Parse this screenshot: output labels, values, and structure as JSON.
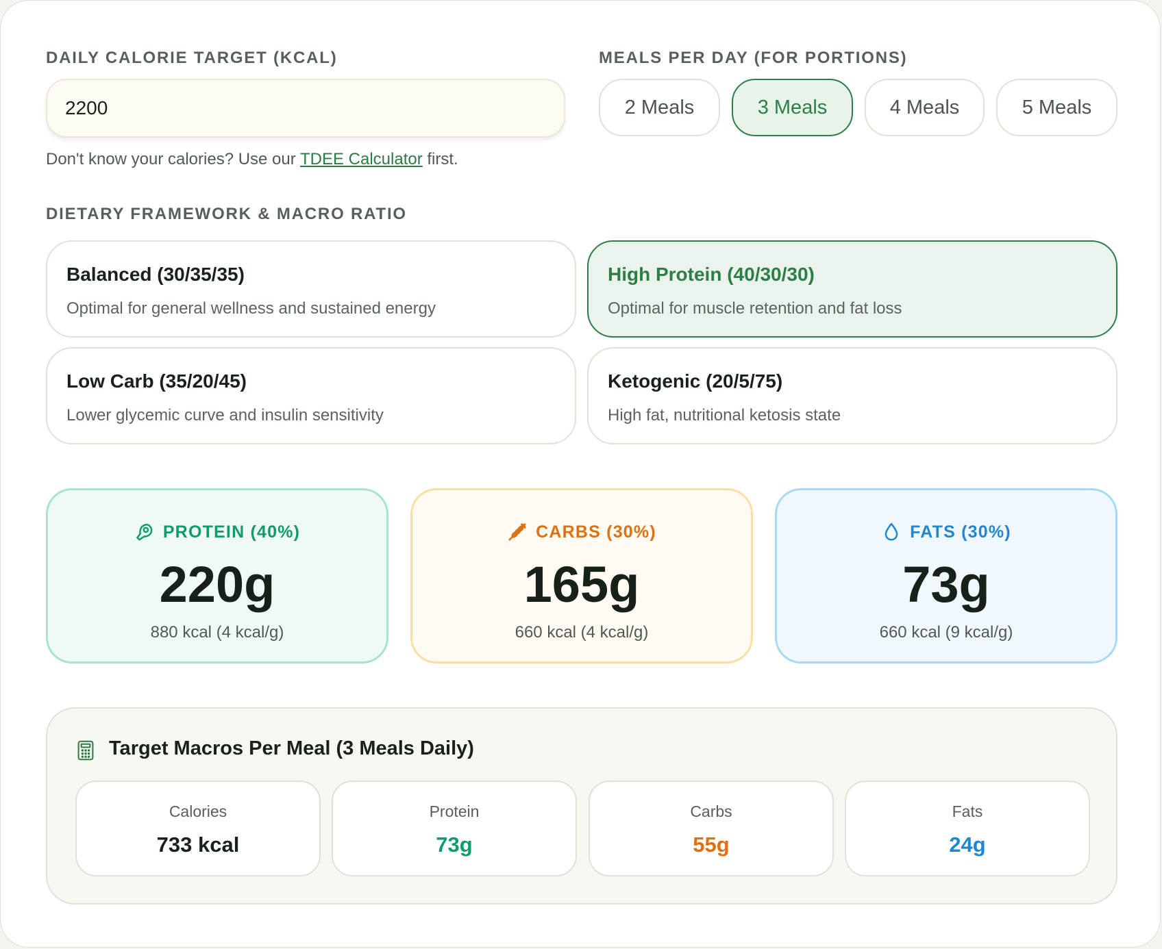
{
  "calorie": {
    "label": "DAILY CALORIE TARGET (KCAL)",
    "value": "2200",
    "helper_prefix": "Don't know your calories? Use our ",
    "helper_link": "TDEE Calculator",
    "helper_suffix": " first."
  },
  "meals": {
    "label": "MEALS PER DAY (FOR PORTIONS)",
    "options": [
      "2 Meals",
      "3 Meals",
      "4 Meals",
      "5 Meals"
    ],
    "selected": "3 Meals"
  },
  "diet": {
    "label": "DIETARY FRAMEWORK & MACRO RATIO",
    "options": [
      {
        "title": "Balanced (30/35/35)",
        "desc": "Optimal for general wellness and sustained energy"
      },
      {
        "title": "High Protein (40/30/30)",
        "desc": "Optimal for muscle retention and fat loss"
      },
      {
        "title": "Low Carb (35/20/45)",
        "desc": "Lower glycemic curve and insulin sensitivity"
      },
      {
        "title": "Ketogenic (20/5/75)",
        "desc": "High fat, nutritional ketosis state"
      }
    ],
    "selected": "High Protein (40/30/30)"
  },
  "macros": {
    "protein": {
      "label": "PROTEIN (40%)",
      "value": "220g",
      "sub": "880 kcal (4 kcal/g)",
      "icon": "protein-icon"
    },
    "carbs": {
      "label": "CARBS (30%)",
      "value": "165g",
      "sub": "660 kcal (4 kcal/g)",
      "icon": "wheat-icon"
    },
    "fats": {
      "label": "FATS (30%)",
      "value": "73g",
      "sub": "660 kcal (9 kcal/g)",
      "icon": "droplet-icon"
    }
  },
  "per_meal": {
    "title": "Target Macros Per Meal (3 Meals Daily)",
    "icon": "calculator-icon",
    "cells": [
      {
        "label": "Calories",
        "value": "733 kcal"
      },
      {
        "label": "Protein",
        "value": "73g"
      },
      {
        "label": "Carbs",
        "value": "55g"
      },
      {
        "label": "Fats",
        "value": "24g"
      }
    ]
  },
  "colors": {
    "accent_green": "#2e7d47",
    "protein": "#109b6c",
    "carbs": "#de7010",
    "fats": "#1f86d0"
  }
}
